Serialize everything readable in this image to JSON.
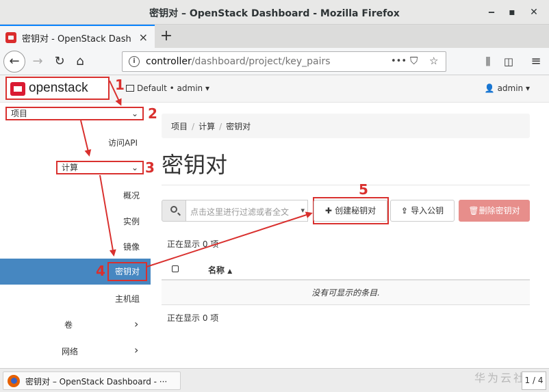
{
  "window": {
    "title": "密钥对 – OpenStack Dashboard - Mozilla Firefox"
  },
  "tab": {
    "title": "密钥对 - OpenStack Dash",
    "close": "×",
    "new_tab": "+"
  },
  "nav": {
    "url_host": "controller",
    "url_path": "/dashboard/project/key_pairs",
    "more": "•••"
  },
  "header": {
    "logo_text": "openstack",
    "project_selector": "Default • admin ▾",
    "user_menu": "admin ▾"
  },
  "sidebar": {
    "project": "项目",
    "api_access": "访问API",
    "compute": "计算",
    "overview": "概况",
    "instances": "实例",
    "images": "镜像",
    "key_pairs": "密钥对",
    "host_groups": "主机组",
    "volumes": "卷",
    "network": "网络"
  },
  "breadcrumb": [
    "项目",
    "计算",
    "密钥对"
  ],
  "page_title": "密钥对",
  "filter": {
    "placeholder": "点击这里进行过滤或者全文"
  },
  "actions": {
    "create": "创建秘钥对",
    "import": "导入公钥",
    "delete": "删除密钥对"
  },
  "table": {
    "showing_top": "正在显示 0 项",
    "column_name": "名称",
    "empty": "没有可显示的条目.",
    "showing_bottom": "正在显示 0 项"
  },
  "annotations": [
    "1",
    "2",
    "3",
    "4",
    "5"
  ],
  "taskbar": {
    "item": "密钥对 – OpenStack Dashboard - ···",
    "pager": "1 / 4",
    "watermark": "华为云社区"
  },
  "colors": {
    "accent_red": "#d9302e",
    "active_blue": "#4687c1",
    "delete_btn": "#e78e8b"
  }
}
